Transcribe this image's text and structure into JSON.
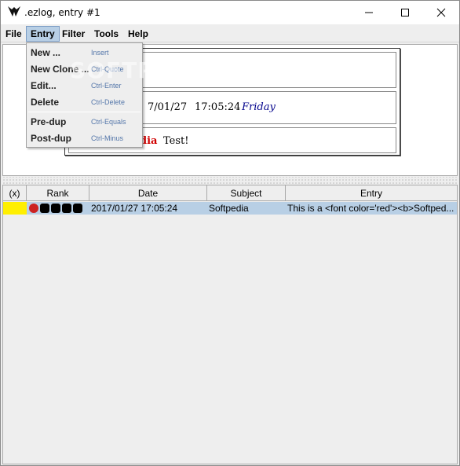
{
  "window": {
    "title": ".ezlog, entry #1"
  },
  "menubar": {
    "file": "File",
    "entry": "Entry",
    "filter": "Filter",
    "tools": "Tools",
    "help": "Help"
  },
  "entry_menu": {
    "items": [
      {
        "label": "New ...",
        "accel": "Insert"
      },
      {
        "label": "New Clone ...",
        "accel": "Ctrl-Quote"
      },
      {
        "label": "Edit...",
        "accel": "Ctrl-Enter"
      },
      {
        "label": "Delete",
        "accel": "Ctrl-Delete"
      },
      {
        "label": "Pre-dup",
        "accel": "Ctrl-Equals"
      },
      {
        "label": "Post-dup",
        "accel": "Ctrl-Minus"
      }
    ]
  },
  "preview": {
    "date": "7/01/27",
    "time": "17:05:24",
    "day": "Friday",
    "body_red": "dia",
    "body_rest": "Test!"
  },
  "watermark": "SOFTPEDIA",
  "table": {
    "headers": [
      "(x)",
      "Rank",
      "Date",
      "Subject",
      "Entry"
    ],
    "rows": [
      {
        "x": "",
        "date": "2017/01/27 17:05:24",
        "subject": "Softpedia",
        "entry": "This is a <font color='red'><b>Softped..."
      }
    ]
  },
  "colors": {
    "selection": "#b8cfe5",
    "flag": "#ffef00",
    "rank_red": "#cc2222",
    "day_text": "#00008b",
    "body_red": "#d00000"
  }
}
